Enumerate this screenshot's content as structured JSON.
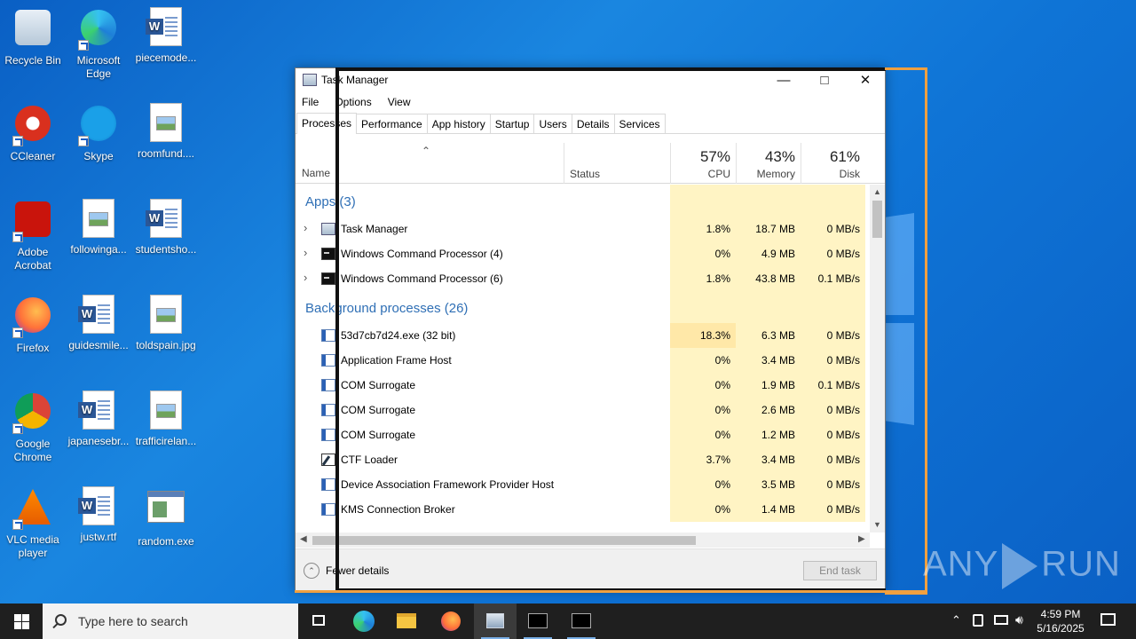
{
  "desktop": {
    "icons": [
      {
        "label": "Recycle Bin",
        "icon": "recycle-bin-icon"
      },
      {
        "label": "Microsoft Edge",
        "icon": "edge-icon"
      },
      {
        "label": "piecemode...",
        "icon": "word-doc-icon"
      },
      {
        "label": "CCleaner",
        "icon": "ccleaner-icon"
      },
      {
        "label": "Skype",
        "icon": "skype-icon"
      },
      {
        "label": "roomfund....",
        "icon": "image-file-icon"
      },
      {
        "label": "Adobe Acrobat",
        "icon": "acrobat-icon"
      },
      {
        "label": "followinga...",
        "icon": "image-file-icon"
      },
      {
        "label": "studentsho...",
        "icon": "word-doc-icon"
      },
      {
        "label": "Firefox",
        "icon": "firefox-icon"
      },
      {
        "label": "guidesmile...",
        "icon": "word-doc-icon"
      },
      {
        "label": "toldspain.jpg",
        "icon": "image-file-icon"
      },
      {
        "label": "Google Chrome",
        "icon": "chrome-icon"
      },
      {
        "label": "japanesebr...",
        "icon": "word-doc-icon"
      },
      {
        "label": "trafficirelan...",
        "icon": "image-file-icon"
      },
      {
        "label": "VLC media player",
        "icon": "vlc-icon"
      },
      {
        "label": "justw.rtf",
        "icon": "word-doc-icon"
      },
      {
        "label": "random.exe",
        "icon": "exe-file-icon"
      }
    ]
  },
  "taskmanager": {
    "title": "Task Manager",
    "menu": [
      "File",
      "Options",
      "View"
    ],
    "tabs": [
      "Processes",
      "Performance",
      "App history",
      "Startup",
      "Users",
      "Details",
      "Services"
    ],
    "header": {
      "name": "Name",
      "status": "Status",
      "cpu_pct": "57%",
      "cpu_label": "CPU",
      "mem_pct": "43%",
      "mem_label": "Memory",
      "disk_pct": "61%",
      "disk_label": "Disk"
    },
    "groups": {
      "apps": "Apps (3)",
      "background": "Background processes (26)"
    },
    "apps": [
      {
        "name": "Task Manager",
        "icon": "task-manager-icon",
        "cpu": "1.8%",
        "memory": "18.7 MB",
        "disk": "0 MB/s"
      },
      {
        "name": "Windows Command Processor (4)",
        "icon": "cmd-icon",
        "cpu": "0%",
        "memory": "4.9 MB",
        "disk": "0 MB/s"
      },
      {
        "name": "Windows Command Processor (6)",
        "icon": "cmd-icon",
        "cpu": "1.8%",
        "memory": "43.8 MB",
        "disk": "0.1 MB/s"
      }
    ],
    "background": [
      {
        "name": "53d7cb7d24.exe (32 bit)",
        "icon": "service-icon",
        "cpu": "18.3%",
        "memory": "6.3 MB",
        "disk": "0 MB/s"
      },
      {
        "name": "Application Frame Host",
        "icon": "service-icon",
        "cpu": "0%",
        "memory": "3.4 MB",
        "disk": "0 MB/s"
      },
      {
        "name": "COM Surrogate",
        "icon": "service-icon",
        "cpu": "0%",
        "memory": "1.9 MB",
        "disk": "0.1 MB/s"
      },
      {
        "name": "COM Surrogate",
        "icon": "service-icon",
        "cpu": "0%",
        "memory": "2.6 MB",
        "disk": "0 MB/s"
      },
      {
        "name": "COM Surrogate",
        "icon": "service-icon",
        "cpu": "0%",
        "memory": "1.2 MB",
        "disk": "0 MB/s"
      },
      {
        "name": "CTF Loader",
        "icon": "ctf-loader-icon",
        "cpu": "3.7%",
        "memory": "3.4 MB",
        "disk": "0 MB/s"
      },
      {
        "name": "Device Association Framework Provider Host",
        "icon": "service-icon",
        "cpu": "0%",
        "memory": "3.5 MB",
        "disk": "0 MB/s"
      },
      {
        "name": "KMS Connection Broker",
        "icon": "service-icon",
        "cpu": "0%",
        "memory": "1.4 MB",
        "disk": "0 MB/s"
      }
    ],
    "footer": {
      "fewer_details": "Fewer details",
      "end_task": "End task"
    }
  },
  "taskbar": {
    "search_placeholder": "Type here to search",
    "time": "4:59 PM",
    "date": "5/16/2025"
  },
  "watermark": {
    "left": "ANY",
    "right": "RUN"
  },
  "colors": {
    "accent": "#2f6fb5",
    "heat_light": "#fff4c4",
    "heat_medium": "#ffe8a8",
    "overlay_orange": "#f0a040"
  }
}
